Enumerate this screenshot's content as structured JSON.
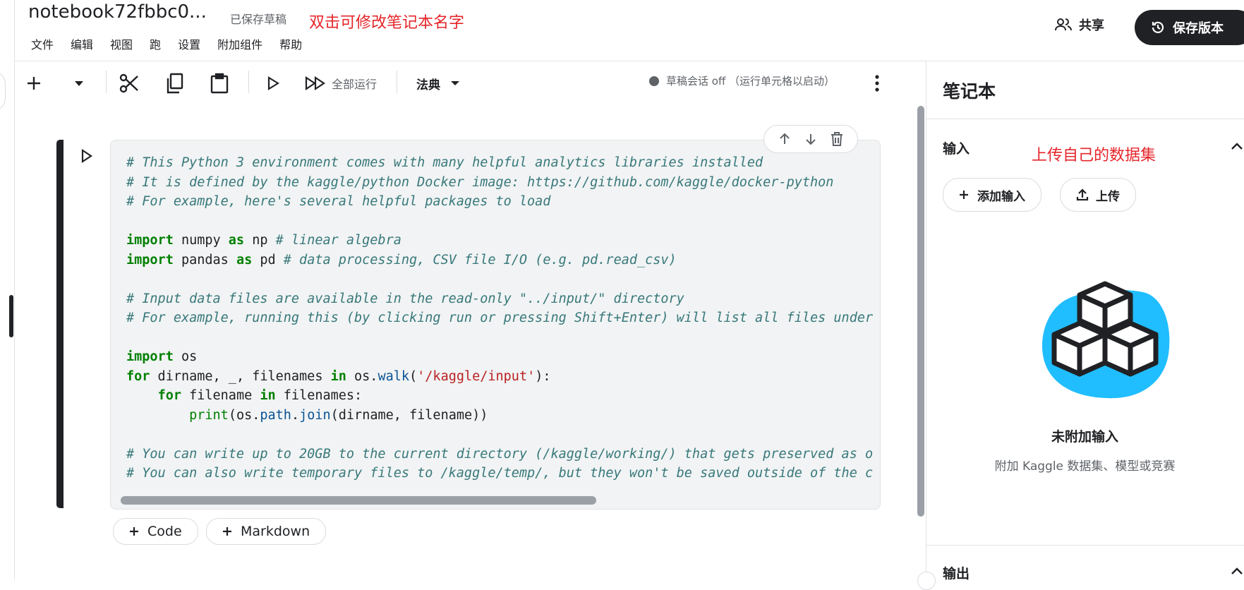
{
  "header": {
    "notebook_title": "notebook72fbbc0...",
    "save_status": "已保存草稿",
    "annotation": "双击可修改笔记本名字",
    "share_label": "共享",
    "save_version_label": "保存版本"
  },
  "menu": [
    "文件",
    "编辑",
    "视图",
    "跑",
    "设置",
    "附加组件",
    "帮助"
  ],
  "toolbar": {
    "run_all_label": "全部运行",
    "cell_type": "法典",
    "session_status": "草稿会话 off （运行单元格以启动）"
  },
  "cell": {
    "code_lines": [
      {
        "parts": [
          {
            "t": "cm",
            "v": "# This Python 3 environment comes with many helpful analytics libraries installed"
          }
        ]
      },
      {
        "parts": [
          {
            "t": "cm",
            "v": "# It is defined by the kaggle/python Docker image: https://github.com/kaggle/docker-python"
          }
        ]
      },
      {
        "parts": [
          {
            "t": "cm",
            "v": "# For example, here's several helpful packages to load"
          }
        ]
      },
      {
        "parts": []
      },
      {
        "parts": [
          {
            "t": "kw",
            "v": "import"
          },
          {
            "t": "",
            "v": " numpy "
          },
          {
            "t": "kw",
            "v": "as"
          },
          {
            "t": "",
            "v": " np "
          },
          {
            "t": "cm",
            "v": "# linear algebra"
          }
        ]
      },
      {
        "parts": [
          {
            "t": "kw",
            "v": "import"
          },
          {
            "t": "",
            "v": " pandas "
          },
          {
            "t": "kw",
            "v": "as"
          },
          {
            "t": "",
            "v": " pd "
          },
          {
            "t": "cm",
            "v": "# data processing, CSV file I/O (e.g. pd.read_csv)"
          }
        ]
      },
      {
        "parts": []
      },
      {
        "parts": [
          {
            "t": "cm",
            "v": "# Input data files are available in the read-only \"../input/\" directory"
          }
        ]
      },
      {
        "parts": [
          {
            "t": "cm",
            "v": "# For example, running this (by clicking run or pressing Shift+Enter) will list all files under"
          }
        ]
      },
      {
        "parts": []
      },
      {
        "parts": [
          {
            "t": "kw",
            "v": "import"
          },
          {
            "t": "",
            "v": " os"
          }
        ]
      },
      {
        "parts": [
          {
            "t": "kw",
            "v": "for"
          },
          {
            "t": "",
            "v": " dirname, _, filenames "
          },
          {
            "t": "kw",
            "v": "in"
          },
          {
            "t": "",
            "v": " os."
          },
          {
            "t": "fn",
            "v": "walk"
          },
          {
            "t": "",
            "v": "("
          },
          {
            "t": "str",
            "v": "'/kaggle/input'"
          },
          {
            "t": "",
            "v": "):"
          }
        ]
      },
      {
        "parts": [
          {
            "t": "",
            "v": "    "
          },
          {
            "t": "kw",
            "v": "for"
          },
          {
            "t": "",
            "v": " filename "
          },
          {
            "t": "kw",
            "v": "in"
          },
          {
            "t": "",
            "v": " filenames:"
          }
        ]
      },
      {
        "parts": [
          {
            "t": "",
            "v": "        "
          },
          {
            "t": "bi",
            "v": "print"
          },
          {
            "t": "",
            "v": "(os."
          },
          {
            "t": "fn",
            "v": "path"
          },
          {
            "t": "",
            "v": "."
          },
          {
            "t": "fn",
            "v": "join"
          },
          {
            "t": "",
            "v": "(dirname, filename))"
          }
        ]
      },
      {
        "parts": []
      },
      {
        "parts": [
          {
            "t": "cm",
            "v": "# You can write up to 20GB to the current directory (/kaggle/working/) that gets preserved as o"
          }
        ]
      },
      {
        "parts": [
          {
            "t": "cm",
            "v": "# You can also write temporary files to /kaggle/temp/, but they won't be saved outside of the c"
          }
        ]
      }
    ]
  },
  "add_cell": {
    "code_label": "Code",
    "markdown_label": "Markdown"
  },
  "panel": {
    "title": "笔记本",
    "input_section": "输入",
    "annotation": "上传自己的数据集",
    "add_input_label": "添加输入",
    "upload_label": "上传",
    "empty_title": "未附加输入",
    "empty_subtitle": "附加 Kaggle 数据集、模型或竞赛",
    "output_section": "输出"
  },
  "colors": {
    "accent": "#20beff",
    "annotation": "#e5262b",
    "dark": "#202124"
  }
}
